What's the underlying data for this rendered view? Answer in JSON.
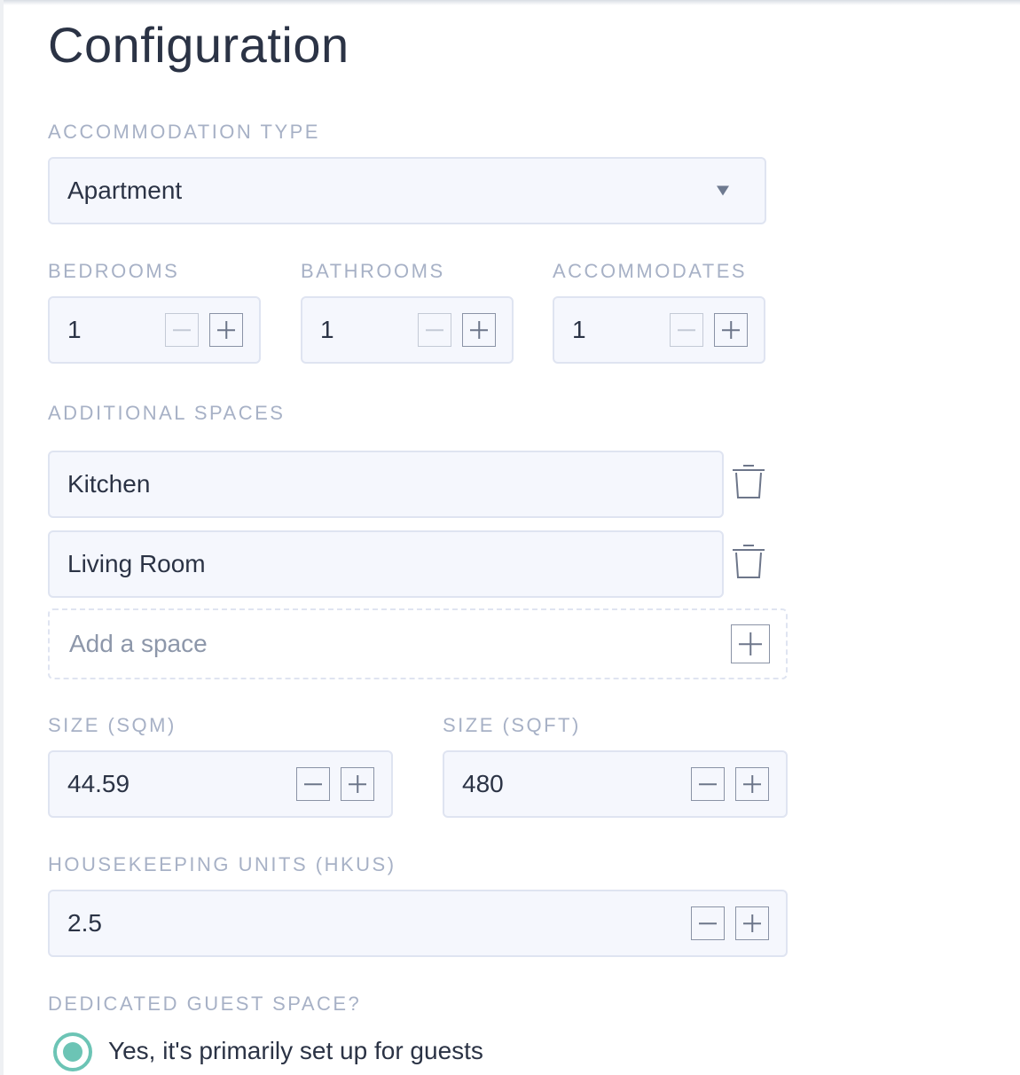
{
  "page": {
    "title": "Configuration"
  },
  "accommodation_type": {
    "label": "ACCOMMODATION TYPE",
    "value": "Apartment"
  },
  "counters": {
    "bedrooms": {
      "label": "BEDROOMS",
      "value": "1"
    },
    "bathrooms": {
      "label": "BATHROOMS",
      "value": "1"
    },
    "accommodates": {
      "label": "ACCOMMODATES",
      "value": "1"
    }
  },
  "additional_spaces": {
    "label": "ADDITIONAL SPACES",
    "items": [
      {
        "value": "Kitchen"
      },
      {
        "value": "Living Room"
      }
    ],
    "add_placeholder": "Add a space"
  },
  "size": {
    "sqm": {
      "label": "SIZE (SQM)",
      "value": "44.59"
    },
    "sqft": {
      "label": "SIZE (SQFT)",
      "value": "480"
    }
  },
  "housekeeping": {
    "label": "HOUSEKEEPING UNITS (HKUS)",
    "value": "2.5"
  },
  "dedicated_guest_space": {
    "label": "DEDICATED GUEST SPACE?",
    "option_selected": "Yes, it's primarily set up for guests"
  },
  "colors": {
    "accent": "#6cc4b5",
    "field_bg": "#f5f7fd",
    "field_border": "#dfe4f1",
    "label": "#a7b1c6",
    "text": "#2b3345"
  }
}
